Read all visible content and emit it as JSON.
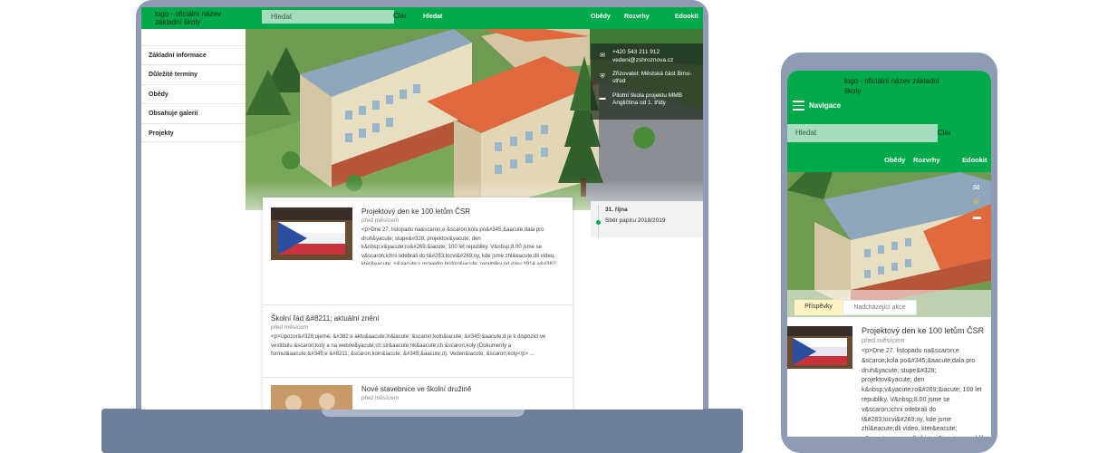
{
  "site": {
    "logo_text": "logo - oficiální název základní školy",
    "search_placeholder": "Hledat",
    "clear_label": "Clear field",
    "nav_top": [
      "Hledat",
      "Obědy",
      "Rozvrhy",
      "Edookit"
    ]
  },
  "sidebar": {
    "items": [
      {
        "label": "Základní informace"
      },
      {
        "label": "Důležité termíny"
      },
      {
        "label": "Obědy"
      },
      {
        "label": "Obsahuje galerii"
      },
      {
        "label": "Projekty"
      }
    ]
  },
  "contact": {
    "phone": "+420 543 211 912",
    "email": "vedeni@zshroznova.cz",
    "founder": "Zřizovatel: Městská část Brno-střed",
    "pilot": "Pilotní škola projektu MMB Angličtina od 1. třídy"
  },
  "posts": [
    {
      "title": "Projektový den ke 100 letům ČSR",
      "date": "před měsícem",
      "body": "<p>Dne 27. listopadu na&scaron;e &scaron;kola po&#345;&aacute;dala pro druh&yacute; stupe&#328; projektov&yacute; den k&nbsp;v&yacute;ro&#269;&iacute; 100 let republiky. V&nbsp;8.00 jsme se v&scaron;ichni odebrali do t&#283;locvi&#269;ny, kde jsme zhl&eacute;dli video, kter&eacute; n&aacute;s provedlo histori&iacute; republiky od roku 1914 a&#382; do roku 1993. Pot&eacute; jsme se seskupili tak, abychom vytvo&#345;ili &#269;eskou vlajku a vyfotili se. N&aacute;sledn&#283; jsme se odebrali do [&hellip;]</p> ..."
    },
    {
      "title": "Školní řád &#8211; aktuální znění",
      "date": "před měsícem",
      "body": "<p>Upozor&#328;ujeme, &#382;e aktu&aacute;ln&iacute; &scaron;koln&iacute; &#345;&aacute;d je k dispozici ve vestibulu &scaron;koly a na webov&yacute;ch str&aacute;nk&aacute;ch &scaron;koly (Dokumenty a formul&aacute;&#345;e &#8211; &scaron;koln&iacute; &#345;&aacute;d). Veden&iacute; &scaron;koly</p> ..."
    },
    {
      "title": "Nové stavebnice ve školní družině",
      "date": "před měsícem"
    }
  ],
  "events": {
    "date": "31. října",
    "text": "Sběr papíru 2018/2019"
  },
  "mobile": {
    "nav_label": "Navigace",
    "links": [
      "Obědy",
      "Rozvrhy",
      "Edookit"
    ],
    "tabs": [
      "Příspěvky",
      "Nadcházející akce"
    ],
    "post": {
      "title": "Projektový den ke 100 letům ČSR",
      "date": "před měsícem",
      "body": "<p>Dne 27. listopadu na&scaron;e &scaron;kola po&#345;&aacute;dala pro druh&yacute; stupe&#328; projektov&yacute; den k&nbsp;v&yacute;ro&#269;&iacute; 100 let republiky. V&nbsp;8.00 jsme se v&scaron;ichni odebrali do t&#283;locvi&#269;ny, kde jsme zhl&eacute;dli video, kter&eacute; n&aacute;s provedlo histori&iacute; republiky od roku 1914 a&#382; do roku 1993."
    }
  },
  "colors": {
    "brand_green": "#00aa4a",
    "search_bg": "#a4dcbe",
    "device_frame": "#8d9bb3"
  }
}
